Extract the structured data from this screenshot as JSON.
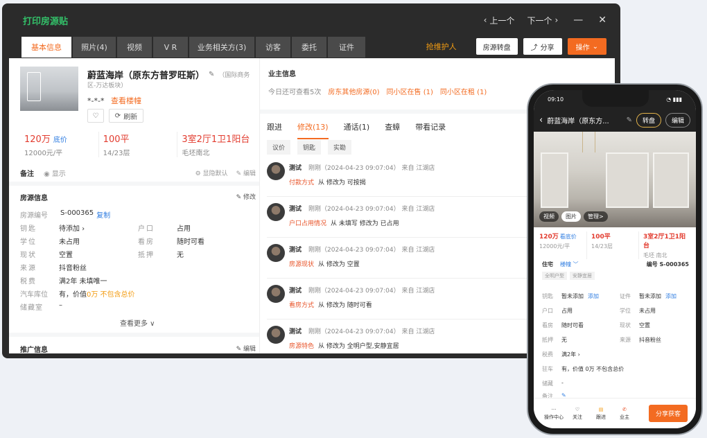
{
  "desktop": {
    "title": "打印房源贴",
    "nav": {
      "prev": "上一个",
      "next": "下一个"
    },
    "tabs": [
      "基本信息",
      "照片(4)",
      "视频",
      "V R",
      "业务相关方(3)",
      "访客",
      "委托",
      "证件"
    ],
    "guard": "抢维护人",
    "transfer_btn": "房源转盘",
    "share_btn": "分享",
    "action_btn": "操作",
    "property": {
      "name": "蔚蓝海岸（原东方普罗旺斯）",
      "district": "（国际商务",
      "district2": "区-万达板块）",
      "masked": "*-*-*",
      "view_unit": "查看楼幢",
      "refresh": "刷新"
    },
    "stats": [
      {
        "value": "120万",
        "tag": "底价",
        "sub": "12000元/平"
      },
      {
        "value": "100平",
        "tag": "",
        "sub": "14/23层"
      },
      {
        "value": "3室2厅1卫1阳台",
        "tag": "",
        "sub": "毛坯南北"
      }
    ],
    "remark": {
      "label": "备注",
      "show": "显示",
      "hide_default": "显隐默认",
      "edit": "编辑"
    },
    "house_info": {
      "title": "房源信息",
      "edit": "修改",
      "id_label": "房源编号",
      "id_value": "S-000365",
      "copy": "复制",
      "rows_left": [
        {
          "k": "钥匙",
          "v": "待添加 ›"
        },
        {
          "k": "学位",
          "v": "未占用"
        },
        {
          "k": "现状",
          "v": "空置"
        },
        {
          "k": "来源",
          "v": "抖音粉丝"
        },
        {
          "k": "税费",
          "v": "满2年 未填唯一"
        }
      ],
      "rows_right": [
        {
          "k": "户口",
          "v": "占用"
        },
        {
          "k": "看房",
          "v": "随时可看"
        },
        {
          "k": "抵押",
          "v": "无"
        }
      ],
      "garage_label": "汽车库位",
      "garage_value": "有，价值",
      "garage_price": "0万 不包含总价",
      "storage_label": "储藏室",
      "storage_value": "–",
      "more": "查看更多 ∨"
    },
    "promo": {
      "title": "推广信息",
      "edit": "编辑"
    },
    "owner": {
      "title": "业主信息",
      "remaining": "今日还可查看5次",
      "other": "房东其他房源(0)",
      "sale": "同小区在售 (1)",
      "rent": "同小区在租 (1)"
    },
    "r_tabs": [
      "跟进",
      "修改(13)",
      "通话(1)",
      "查蟑",
      "带看记录"
    ],
    "chips": [
      "议价",
      "钥匙",
      "实勘"
    ],
    "logs": [
      {
        "user": "测试",
        "meta": "刚刚（2024-04-23 09:07:04） 来自 江湖店",
        "field": "付款方式",
        "text": "从 修改为 可按揭"
      },
      {
        "user": "测试",
        "meta": "刚刚（2024-04-23 09:07:04） 来自 江湖店",
        "field": "户口占用情况",
        "text": "从 未填写 修改为 已占用"
      },
      {
        "user": "测试",
        "meta": "刚刚（2024-04-23 09:07:04） 来自 江湖店",
        "field": "房源现状",
        "text": "从 修改为 空置"
      },
      {
        "user": "测试",
        "meta": "刚刚（2024-04-23 09:07:04） 来自 江湖店",
        "field": "看房方式",
        "text": "从 修改为 随时可看"
      },
      {
        "user": "测试",
        "meta": "刚刚（2024-04-23 09:07:04） 来自 江湖店",
        "field": "房源特色",
        "text": "从 修改为 全明户型,安静宜居"
      }
    ]
  },
  "phone": {
    "time": "09:10",
    "title": "蔚蓝海岸（原东方...",
    "transfer": "转盘",
    "edit": "编辑",
    "photo_btns": [
      "视频",
      "图片",
      "管理>"
    ],
    "stats": [
      {
        "value": "120万",
        "tag": "看底价",
        "sub": "12000元/平"
      },
      {
        "value": "100平",
        "tag": "",
        "sub": "14/23层"
      },
      {
        "value": "3室2厅1卫1阳台",
        "tag": "",
        "sub": "毛坯 南北"
      }
    ],
    "type": "住宅",
    "unit": "楼幢 ﹀",
    "number": "编号 S-000365",
    "tags": [
      "全明户型",
      "安静宜居"
    ],
    "rows": [
      {
        "k": "钥匙",
        "v": "暂未添加",
        "a": "添加",
        "k2": "证件",
        "v2": "暂未添加",
        "a2": "添加"
      },
      {
        "k": "户口",
        "v": "占用",
        "a": "",
        "k2": "学位",
        "v2": "未占用",
        "a2": ""
      },
      {
        "k": "看房",
        "v": "随时可看",
        "a": "",
        "k2": "现状",
        "v2": "空置",
        "a2": ""
      },
      {
        "k": "抵押",
        "v": "无",
        "a": "",
        "k2": "来源",
        "v2": "抖音粉丝",
        "a2": ""
      }
    ],
    "tax": {
      "k": "税费",
      "v": "满2年 ›"
    },
    "parking": {
      "k": "驻车",
      "v": "有，价值 0万 不包含总价"
    },
    "storage": {
      "k": "储藏",
      "v": "-"
    },
    "note": {
      "k": "备注",
      "v": "✎"
    },
    "tabbar": [
      "操作中心",
      "关注",
      "跟进",
      "业主"
    ],
    "share": "分享获客"
  }
}
